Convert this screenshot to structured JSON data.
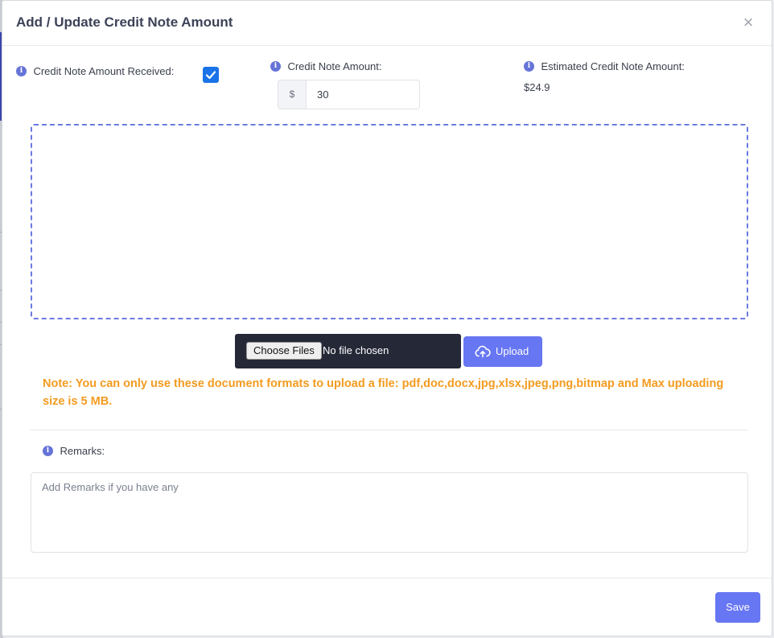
{
  "dialog": {
    "title": "Add / Update Credit Note Amount",
    "close_label": "×"
  },
  "fields": {
    "received_label": "Credit Note Amount Received:",
    "received_checked": true,
    "amount_label": "Credit Note Amount:",
    "currency_prefix": "$",
    "amount_value": "30",
    "estimated_label": "Estimated Credit Note Amount:",
    "estimated_value": "$24.9"
  },
  "upload": {
    "choose_files_label": "Choose Files",
    "no_file_text": "No file chosen",
    "upload_label": "Upload",
    "note": "Note: You can only use these document formats to upload a file: pdf,doc,docx,jpg,xlsx,jpeg,png,bitmap and Max uploading size is 5 MB."
  },
  "remarks": {
    "label": "Remarks:",
    "placeholder": "Add Remarks if you have any",
    "value": ""
  },
  "footer": {
    "save_label": "Save"
  },
  "icons": {
    "info": "info-icon",
    "check": "check-icon",
    "upload": "cloud-upload-icon",
    "close": "close-icon"
  },
  "colors": {
    "primary": "#6776f2",
    "info_icon": "#6674d8",
    "checkbox": "#1a73e8",
    "note": "#f39b1f",
    "dropzone_border": "#6b7be0",
    "title": "#3c4257"
  }
}
